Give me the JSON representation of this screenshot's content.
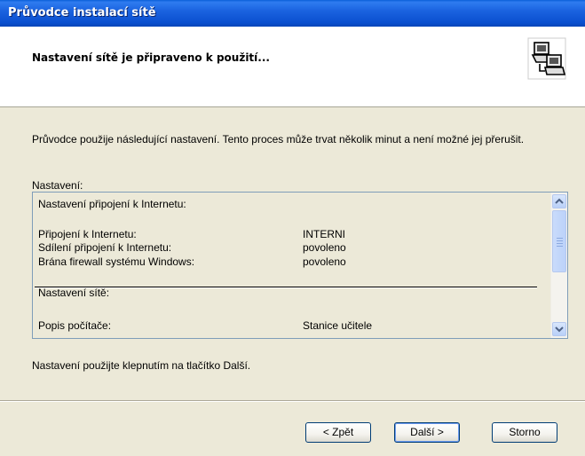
{
  "window": {
    "title": "Průvodce instalací sítě"
  },
  "header": {
    "title": "Nastavení sítě je připraveno k použití..."
  },
  "intro_text": "Průvodce použije následující nastavení. Tento proces může trvat několik minut a není možné jej přerušit.",
  "settings": {
    "label": "Nastavení:",
    "internet_section": "Nastavení připojení k Internetu:",
    "rows": [
      {
        "label": "Připojení k Internetu:",
        "value": "INTERNI"
      },
      {
        "label": "Sdílení připojení k Internetu:",
        "value": "povoleno"
      },
      {
        "label": "Brána firewall systému Windows:",
        "value": "povoleno"
      }
    ],
    "network_section": "Nastavení sítě:",
    "computer_row": {
      "label": "Popis počítače:",
      "value": "Stanice učitele"
    }
  },
  "footer_text": "Nastavení použijte klepnutím na tlačítko Další.",
  "buttons": {
    "back": "< Zpět",
    "next": "Další >",
    "cancel": "Storno"
  },
  "icons": {
    "header": "network-computers-icon"
  }
}
